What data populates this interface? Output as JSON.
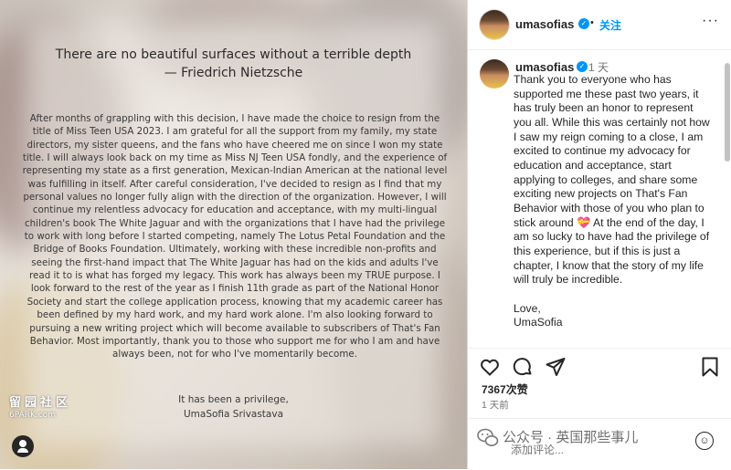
{
  "post": {
    "quote_line1": "There are no beautiful surfaces without a terrible depth",
    "quote_line2": "— Friedrich Nietzsche",
    "letter": "After months of grappling with this decision, I have made the choice to resign from the title of Miss Teen USA 2023. I am grateful for all the support from my family, my state directors, my sister queens, and the fans who have cheered me on since I won my state title. I will always look back on my time as Miss NJ Teen USA fondly, and the experience of representing my state as a first generation, Mexican-Indian American at the national level was fulfilling in itself. After careful consideration, I've decided to resign as I find that my personal values no longer fully align with the direction of the organization. However, I will continue my relentless advocacy for education and acceptance, with my multi-lingual children's book The White Jaguar and with the organizations that I have had the privilege to work with long before I started competing, namely The Lotus Petal Foundation and the Bridge of Books Foundation. Ultimately, working with these incredible non-profits and seeing the first-hand impact that The White Jaguar has had on the kids and adults I've read it to is what has forged my legacy. This work has always been my TRUE purpose. I look forward to the rest of the year as I finish 11th grade as part of the National Honor Society and start the college application process, knowing that my academic career has been defined by my hard work, and my hard work alone. I'm also looking forward to pursuing a new writing project which will become available to subscribers of That's Fan Behavior. Most importantly, thank you to those who support me for who I am and have always been, not for who I've momentarily become.",
    "sign_line1": "It has been a privilege,",
    "sign_line2": "UmaSofia Srivastava",
    "watermark_cn": "留园社区",
    "watermark_en": "6PARK.com"
  },
  "header": {
    "username": "umasofias",
    "verified_glyph": "✓",
    "separator": "•",
    "follow_label": "关注",
    "more_glyph": "···"
  },
  "caption": {
    "username": "umasofias",
    "verified_glyph": "✓",
    "time": "1 天",
    "text": "Thank you to everyone who has supported me these past two years, it has truly been an honor to represent you all. While this was certainly not how I saw my reign coming to a close, I am excited to continue my advocacy for education and acceptance, start applying to colleges, and share some exciting new projects on That's Fan Behavior with those of you who plan to stick around 💝 At the end of the day, I am so lucky to have had the privilege of this experience, but if this is just a chapter, I know that the story of my life will truly be incredible.\n\nLove,\nUmaSofia"
  },
  "stats": {
    "likes": "7367次赞",
    "ago": "1 天前"
  },
  "comment": {
    "placeholder": "添加评论...",
    "wechat_watermark": "公众号 · 英国那些事儿"
  },
  "colors": {
    "accent": "#0095f6",
    "text": "#262626",
    "muted": "#737373"
  }
}
